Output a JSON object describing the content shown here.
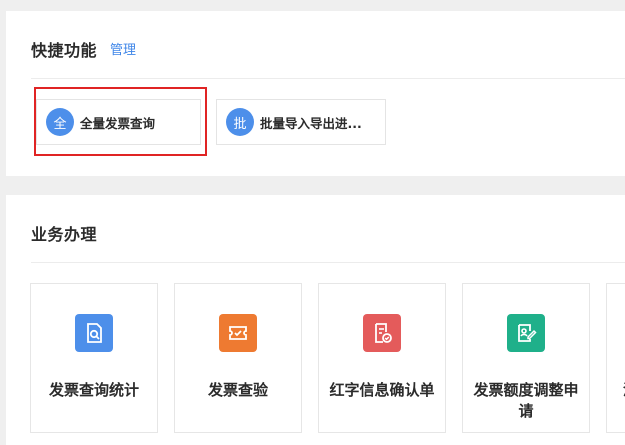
{
  "quick": {
    "title": "快捷功能",
    "manage_label": "管理",
    "items": [
      {
        "badge": "全",
        "label": "全量发票查询",
        "highlighted": true
      },
      {
        "badge": "批",
        "label": "批量导入导出进..."
      }
    ]
  },
  "business": {
    "title": "业务办理",
    "cards": [
      {
        "label": "发票查询统计",
        "icon": "invoice-search-icon",
        "color": "#4d8fea"
      },
      {
        "label": "发票查验",
        "icon": "ticket-verify-icon",
        "color": "#ee7a31"
      },
      {
        "label": "红字信息确认单",
        "icon": "red-invoice-confirm-icon",
        "color": "#e45b5b"
      },
      {
        "label": "发票额度调整申请",
        "icon": "quota-adjust-icon",
        "color": "#1fb08a"
      },
      {
        "label": "湿",
        "icon": "",
        "color": ""
      }
    ]
  },
  "colors": {
    "accent": "#3f86e8",
    "highlight": "#e02424"
  }
}
